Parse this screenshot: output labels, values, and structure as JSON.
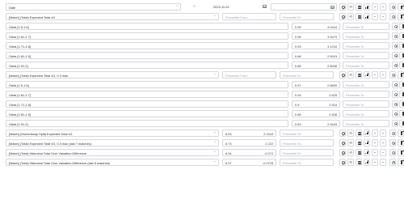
{
  "header": {
    "field": "Date",
    "operator": "=",
    "value": "2023-11-01"
  },
  "placeholders": {
    "from": "Percentile From",
    "to": "Percentile To"
  },
  "rows": [
    {
      "label": "Odds [1.5-1.6]",
      "value": "0.99",
      "score": "4.0444"
    },
    {
      "label": "Odds [1.61-1.7]",
      "value": "0.96",
      "score": "3.3479"
    },
    {
      "label": "Odds [1.71-1.8]",
      "value": "0.93",
      "score": "3.1234"
    },
    {
      "label": "Odds [1.81-1.9]",
      "value": "0.88",
      "score": "2.9015"
    },
    {
      "label": "Odds [1.91-2]",
      "value": "0.85",
      "score": "2.8938"
    },
    {
      "label": "Odds [1.5-1.6]",
      "value": "0.97",
      "score": "2.8899"
    },
    {
      "label": "Odds [1.61-1.7]",
      "value": "0.93",
      "score": "2.625"
    },
    {
      "label": "Odds [1.71-1.8]",
      "value": "0.9",
      "score": "2.516"
    },
    {
      "label": "Odds [1.81-1.9]",
      "value": "0.85",
      "score": "2.538"
    },
    {
      "label": "Odds [1.91-2]",
      "value": "0.83",
      "score": "2.3443"
    }
  ],
  "metrics": [
    {
      "label": "[Match] (Total) Expected Total xG"
    },
    {
      "label": "[Match] (Total) Expected Total xG, 0.3 max"
    }
  ],
  "bottom_rows": [
    {
      "label": "[Match] (Home/Away Split) Expected Total xG",
      "value": "8.53",
      "score": "2.2443"
    },
    {
      "label": "[Match] (Total) Expected Total xG, 0.3 max (last 7 matches)",
      "value": "8.73",
      "score": "2.222"
    },
    {
      "label": "[Match] (Total) Historical Total Over Valuation Difference",
      "value": "8.34",
      "score": "-0.072"
    },
    {
      "label": "[Match] (Total) Historical Total Over Valuation Difference (last 5 matches)",
      "value": "8.37",
      "score": "-0.0725"
    }
  ],
  "icons": {
    "x": "×",
    "chevron": "⌃",
    "calendar": "calendar-icon",
    "refresh": "⟲",
    "sort": "⇅",
    "bars": "bar-chart-icon"
  }
}
